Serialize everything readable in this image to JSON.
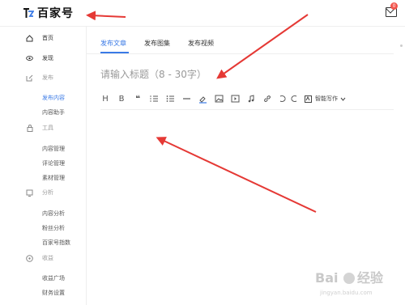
{
  "header": {
    "logo_text": "百家号",
    "notification_count": "0",
    "logo_icon": "baijiahao-logo",
    "mail_icon": "mail-icon"
  },
  "sidebar": {
    "items": [
      {
        "label": "首页",
        "icon": "home-icon"
      },
      {
        "label": "发现",
        "icon": "eye-icon"
      },
      {
        "label": "发布",
        "icon": "edit-icon"
      },
      {
        "label": "发布内容"
      },
      {
        "label": "内容助手"
      },
      {
        "label": "工具",
        "icon": "lock-icon"
      },
      {
        "label": "内容管理"
      },
      {
        "label": "评论管理"
      },
      {
        "label": "素材管理"
      },
      {
        "label": "分析",
        "icon": "chart-icon"
      },
      {
        "label": "内容分析"
      },
      {
        "label": "粉丝分析"
      },
      {
        "label": "百家号指数"
      },
      {
        "label": "收益",
        "icon": "coin-icon"
      },
      {
        "label": "收益广场"
      },
      {
        "label": "财务设置"
      }
    ]
  },
  "tabs": [
    {
      "label": "发布文章"
    },
    {
      "label": "发布图集"
    },
    {
      "label": "发布视频"
    }
  ],
  "title_input": {
    "placeholder": "请输入标题（8 - 30字）",
    "value": ""
  },
  "toolbar": {
    "heading": "H",
    "bold": "B",
    "quote": "❝",
    "ai_write_label": "智能写作"
  },
  "colors": {
    "accent": "#3a7ae6",
    "arrow": "#e53935",
    "badge": "#f2554d"
  }
}
